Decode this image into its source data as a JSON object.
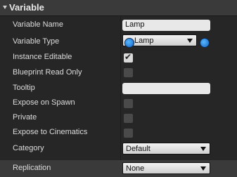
{
  "section": {
    "title": "Variable"
  },
  "rows": {
    "variable_name": {
      "label": "Variable Name",
      "value": "Lamp"
    },
    "variable_type": {
      "label": "Variable Type",
      "value": "Lamp"
    },
    "instance_editable": {
      "label": "Instance Editable",
      "checked": true
    },
    "blueprint_read_only": {
      "label": "Blueprint Read Only",
      "checked": false
    },
    "tooltip": {
      "label": "Tooltip",
      "value": ""
    },
    "expose_on_spawn": {
      "label": "Expose on Spawn",
      "checked": false
    },
    "private": {
      "label": "Private",
      "checked": false
    },
    "expose_to_cinematics": {
      "label": "Expose to Cinematics",
      "checked": false
    },
    "category": {
      "label": "Category",
      "value": "Default"
    },
    "replication": {
      "label": "Replication",
      "value": "None"
    }
  },
  "colors": {
    "pin": "#1e7be0",
    "panel": "#262626",
    "header": "#3a3a3a"
  },
  "icons": {
    "pin": "object-pin-icon",
    "section_arrow": "collapse-arrow-icon"
  }
}
